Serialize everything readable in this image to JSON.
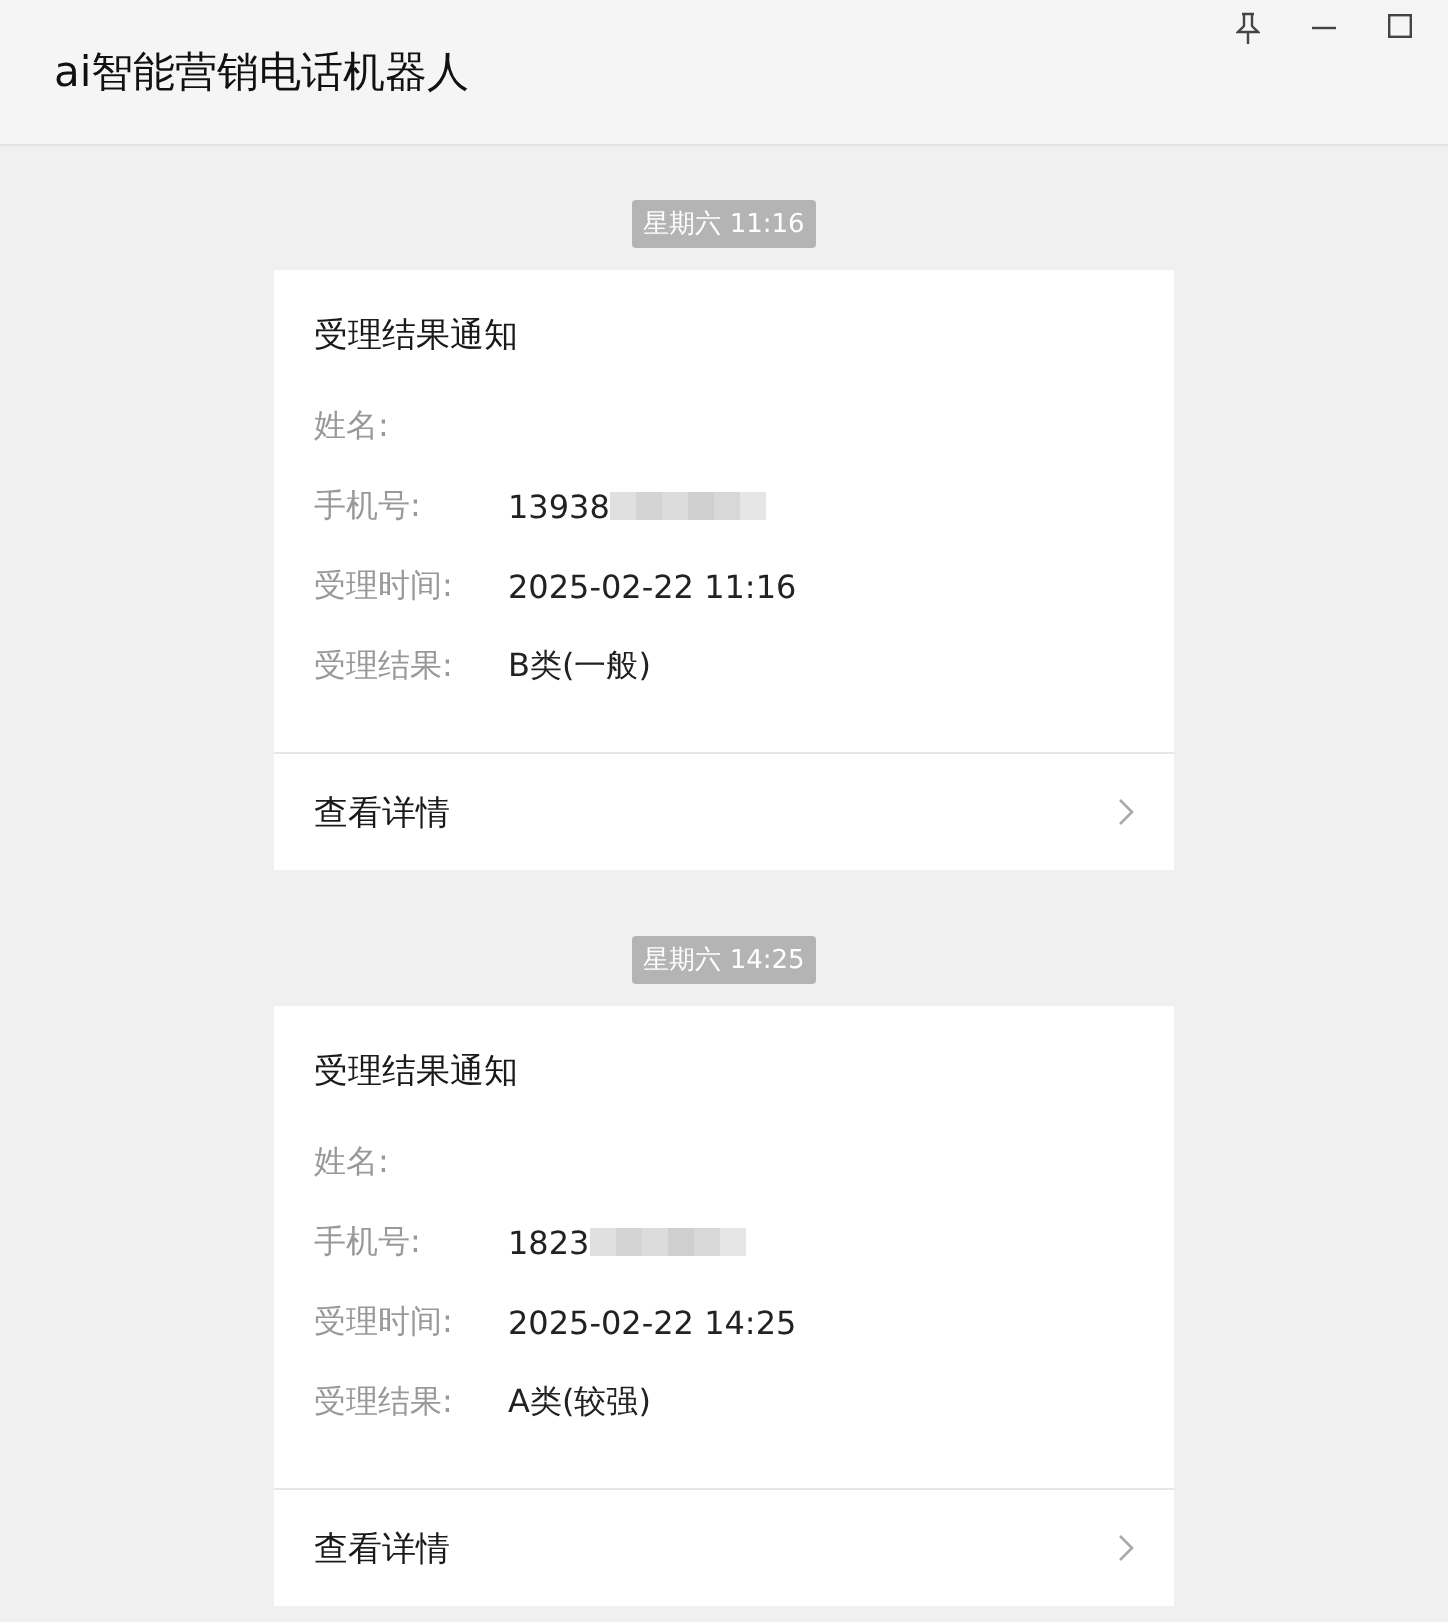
{
  "window": {
    "title": "ai智能营销电话机器人"
  },
  "messages": [
    {
      "time": "星期六 11:16",
      "title": "受理结果通知",
      "fields": [
        {
          "label": "姓名:"
        },
        {
          "label": "手机号:",
          "value": "13938",
          "redacted": true
        },
        {
          "label": "受理时间:",
          "value": "2025-02-22 11:16"
        },
        {
          "label": "受理结果:",
          "value": "B类(一般)"
        }
      ],
      "link": "查看详情"
    },
    {
      "time": "星期六 14:25",
      "title": "受理结果通知",
      "fields": [
        {
          "label": "姓名:"
        },
        {
          "label": "手机号:",
          "value": "1823",
          "redacted": true
        },
        {
          "label": "受理时间:",
          "value": "2025-02-22 14:25"
        },
        {
          "label": "受理结果:",
          "value": "A类(较强)"
        }
      ],
      "link": "查看详情"
    }
  ]
}
